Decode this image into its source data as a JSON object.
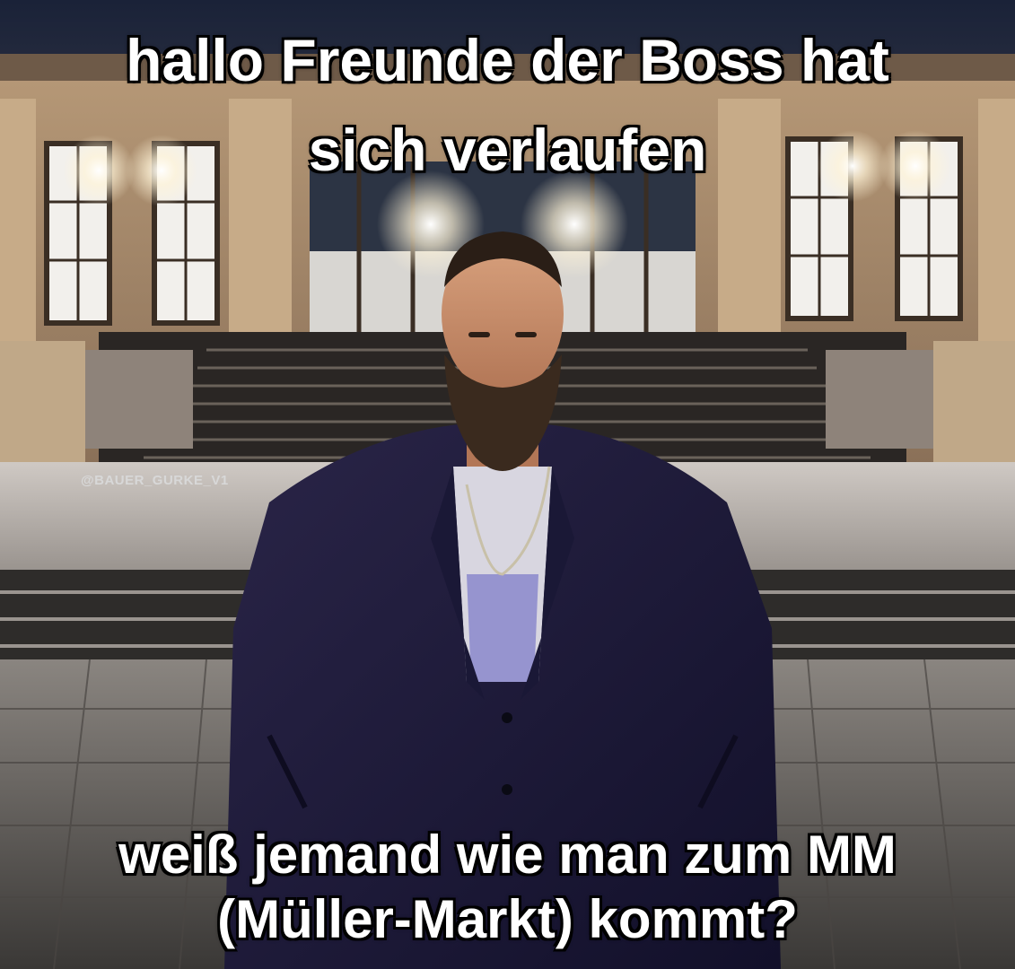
{
  "caption": {
    "top_line_1": "hallo Freunde der Boss hat",
    "top_line_2": "sich verlaufen",
    "bottom_line_1": "weiß jemand wie man zum MM",
    "bottom_line_2": "(Müller-Markt) kommt?"
  },
  "watermark": "@BAUER_GURKE_V1"
}
